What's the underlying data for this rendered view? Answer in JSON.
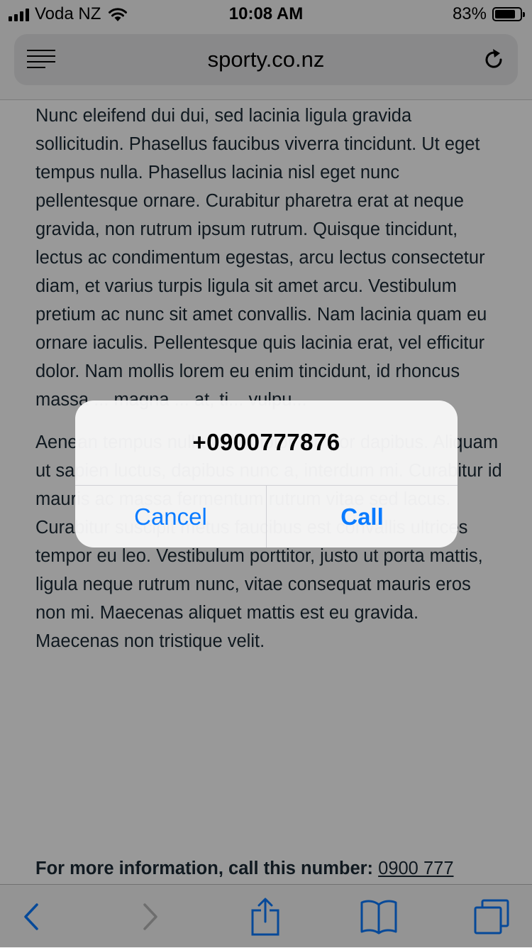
{
  "status_bar": {
    "carrier": "Voda NZ",
    "time": "10:08 AM",
    "battery_percent": "83%",
    "battery_level": 0.83
  },
  "browser": {
    "url": "sporty.co.nz",
    "reader_icon": "reader-mode-icon",
    "reload_icon": "reload-icon"
  },
  "page": {
    "paragraphs": [
      "Nunc eleifend dui dui, sed lacinia ligula gravida sollicitudin. Phasellus faucibus viverra tincidunt. Ut eget tempus nulla. Phasellus lacinia nisl eget nunc pellentesque ornare. Curabitur pharetra erat at neque gravida, non rutrum ipsum rutrum. Quisque tincidunt, lectus ac condimentum egestas, arcu lectus consectetur diam, et varius turpis ligula sit amet arcu. Vestibulum pretium ac nunc sit amet convallis. Nam lacinia quam eu ornare iaculis. Pellentesque quis lacinia erat, vel efficitur dolor. Nam mollis lorem eu enim tincidunt, id rhoncus massa ... magna ... at, ti... vulpu...",
      "Aenean tempus nulla vitae dolor tempor dapibus. Aliquam ut sapien luctus, dapibus nunc a, interdum mi. Curabitur id mauris ac massa fermentum rutrum vitae sed lacus. Curabitur suscipit metus faucibus est convallis ultrices tempor eu leo. Vestibulum porttitor, justo ut porta mattis, ligula neque rutrum nunc, vitae consequat mauris eros non mi. Maecenas aliquet mattis est eu gravida. Maecenas non tristique velit."
    ],
    "more_info_label": "For more information, call this number:",
    "more_info_phone": "0900 777"
  },
  "toolbar": {
    "back_icon": "back-chevron-icon",
    "forward_icon": "forward-chevron-icon",
    "share_icon": "share-icon",
    "bookmarks_icon": "bookmarks-icon",
    "tabs_icon": "tabs-icon"
  },
  "alert": {
    "title": "+0900777876",
    "cancel_label": "Cancel",
    "call_label": "Call",
    "accent_color": "#0a7bff"
  }
}
